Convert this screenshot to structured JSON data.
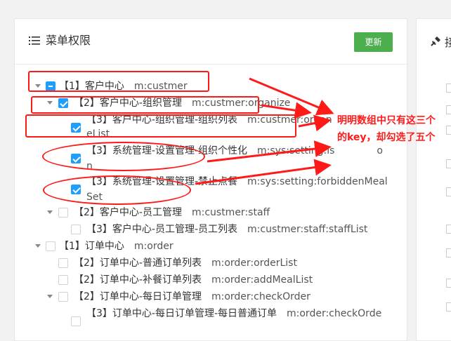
{
  "header": {
    "title": "菜单权限",
    "update_label": "更新"
  },
  "side": {
    "title": "接"
  },
  "tree": [
    {
      "label": "【1】客户中心",
      "code": "m:custmer"
    },
    {
      "label": "【2】客户中心-组织管理",
      "code": "m:custmer:organize"
    },
    {
      "label": "【3】客户中心-组织管理-组织列表",
      "code": "m:custmer:organ",
      "wrap": "eList"
    },
    {
      "label": "【3】系统管理-设置管理-组织个性化",
      "code": "m:sys:setting:is",
      "code_tail": "o",
      "wrap": "n"
    },
    {
      "label": "【3】系统管理-设置管理-禁止点餐",
      "code": "m:sys:setting:forbiddenMeal",
      "wrap": "Set"
    },
    {
      "label": "【2】客户中心-员工管理",
      "code": "m:custmer:staff"
    },
    {
      "label": "【3】客户中心-员工管理-员工列表",
      "code": "m:custmer:staff:staffList"
    },
    {
      "label": "【1】订单中心",
      "code": "m:order"
    },
    {
      "label": "【2】订单中心-普通订单列表",
      "code": "m:order:orderList"
    },
    {
      "label": "【2】订单中心-补餐订单列表",
      "code": "m:order:addMealList"
    },
    {
      "label": "【2】订单中心-每日订单管理",
      "code": "m:order:checkOrder"
    },
    {
      "label": "【3】订单中心-每日订单管理-每日普通订单",
      "code": "m:order:checkOrde"
    }
  ],
  "annotation": {
    "text": "明明数组中只有这三个的key，却勾选了五个"
  },
  "colors": {
    "accent": "#1e9fff",
    "button": "#4cae4c",
    "annotation": "#ff1a1a"
  }
}
